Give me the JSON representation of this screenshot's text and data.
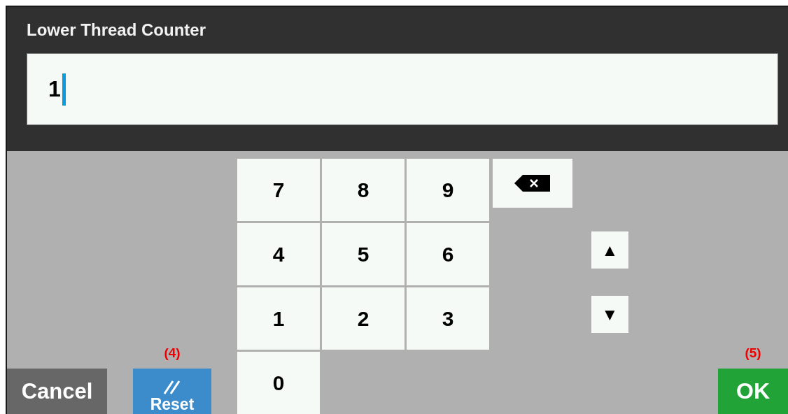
{
  "dialog": {
    "title": "Lower Thread Counter",
    "field": {
      "value": "1"
    }
  },
  "keypad": {
    "keys": [
      "7",
      "8",
      "9",
      "4",
      "5",
      "6",
      "1",
      "2",
      "3",
      "0"
    ]
  },
  "arrows": [
    "▲",
    "▼"
  ],
  "actions": [
    {
      "kind": "cancel",
      "label": "Cancel"
    },
    {
      "kind": "reset",
      "label": "Reset",
      "annotation": "(4)"
    },
    {
      "kind": "ok",
      "label": "OK",
      "annotation": "(5)"
    }
  ]
}
